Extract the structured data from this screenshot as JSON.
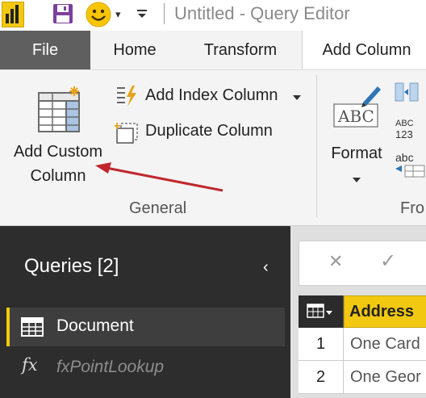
{
  "window": {
    "title": "Untitled - Query Editor"
  },
  "tabs": {
    "file": "File",
    "home": "Home",
    "transform": "Transform",
    "add_column": "Add Column"
  },
  "ribbon": {
    "add_custom_column_line1": "Add Custom",
    "add_custom_column_line2": "Column",
    "add_index_column": "Add Index Column",
    "duplicate_column": "Duplicate Column",
    "format": "Format",
    "group_general": "General",
    "group_from_partial": "Fro",
    "abc_label": "ABC",
    "abc_small": "ABC",
    "num_123": "123",
    "abc_lower": "abc"
  },
  "queries_pane": {
    "title": "Queries [2]",
    "items": [
      {
        "label": "Document",
        "icon": "table-icon",
        "selected": true
      },
      {
        "label": "fxPointLookup",
        "icon": "fx-icon",
        "selected": false
      }
    ]
  },
  "formula_bar": {
    "cancel_glyph": "✕",
    "accept_glyph": "✓"
  },
  "grid": {
    "columns": [
      "Address"
    ],
    "rows": [
      {
        "num": "1",
        "address": "One Card"
      },
      {
        "num": "2",
        "address": "One Geor"
      }
    ]
  },
  "annotation": {
    "arrow_color": "#c0282d"
  },
  "colors": {
    "accent": "#f2c811",
    "file_tab": "#5f5f5f",
    "queries_pane_bg": "#2d2d2d"
  }
}
